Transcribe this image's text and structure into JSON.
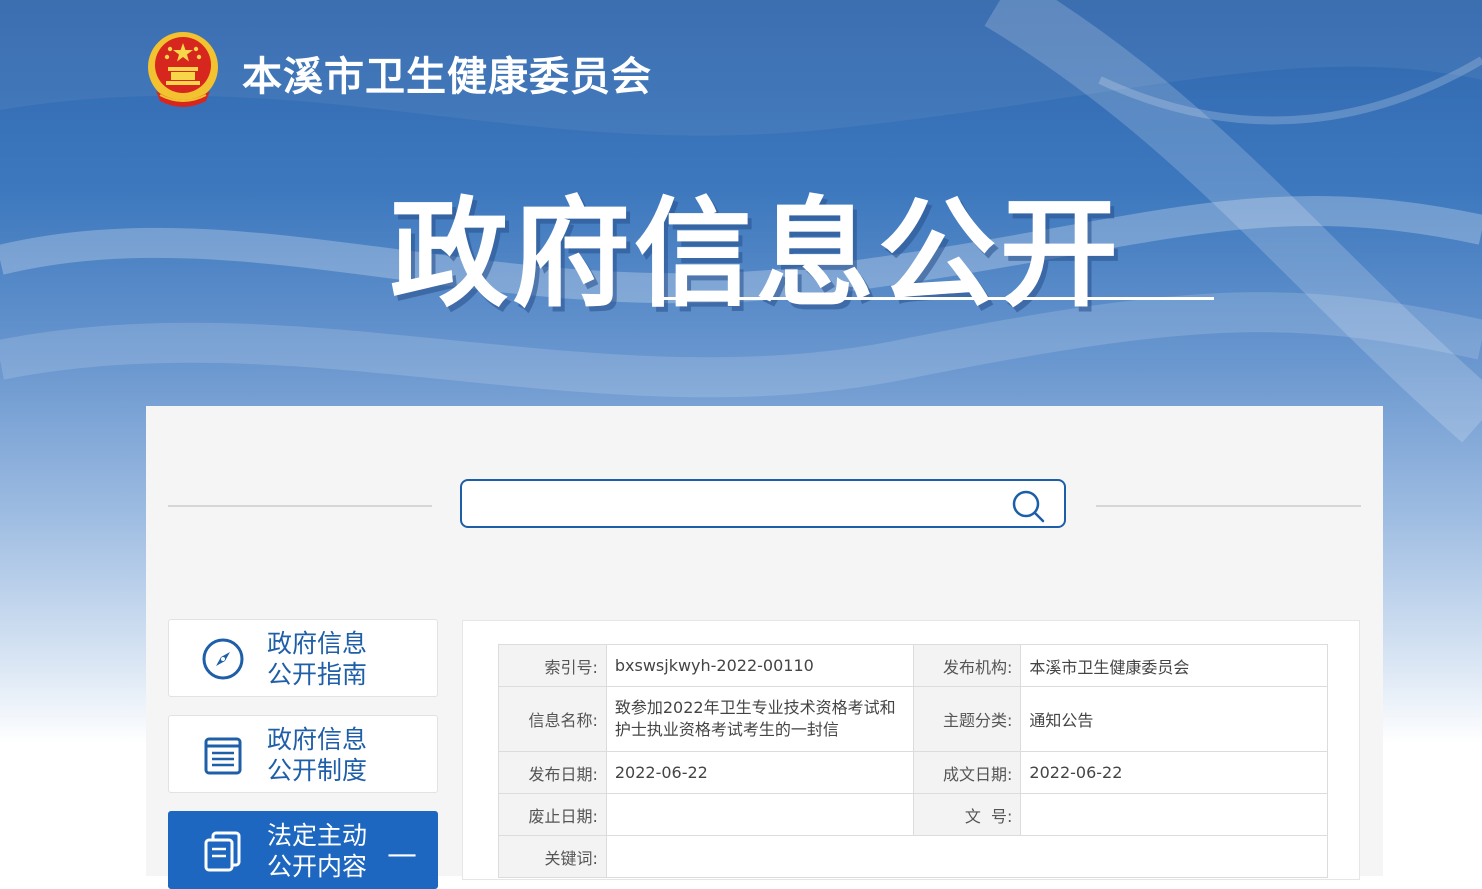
{
  "header": {
    "site_name": "本溪市卫生健康委员会",
    "section_title": "政府信息公开"
  },
  "search": {
    "value": "",
    "placeholder": ""
  },
  "sidebar": {
    "items": [
      {
        "line1": "政府信息",
        "line2": "公开指南",
        "icon": "compass-icon",
        "active": false
      },
      {
        "line1": "政府信息",
        "line2": "公开制度",
        "icon": "document-list-icon",
        "active": false
      },
      {
        "line1": "法定主动",
        "line2": "公开内容",
        "icon": "files-icon",
        "active": true,
        "toggle": "—"
      }
    ]
  },
  "info_table": {
    "index_label": "索引号:",
    "index_value": "bxswsjkwyh-2022-00110",
    "publisher_label": "发布机构:",
    "publisher_value": "本溪市卫生健康委员会",
    "name_label": "信息名称:",
    "name_value": "致参加2022年卫生专业技术资格考试和护士执业资格考试考生的一封信",
    "topic_label": "主题分类:",
    "topic_value": "通知公告",
    "pub_date_label": "发布日期:",
    "pub_date_value": "2022-06-22",
    "doc_date_label": "成文日期:",
    "doc_date_value": "2022-06-22",
    "expire_label": "废止日期:",
    "expire_value": "",
    "doc_no_label": "文  号:",
    "doc_no_value": "",
    "keywords_label": "关键词:",
    "keywords_value": ""
  },
  "colors": {
    "brand_blue": "#1d67c0",
    "link_blue": "#1f5fa8"
  }
}
